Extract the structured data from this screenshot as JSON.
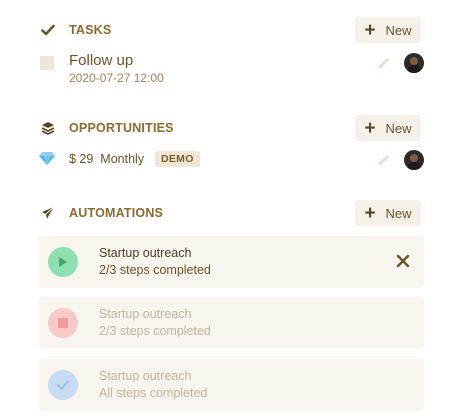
{
  "tasks": {
    "title": "TASKS",
    "new_label": "New",
    "items": [
      {
        "title": "Follow up",
        "date": "2020-07-27 12:00"
      }
    ]
  },
  "opportunities": {
    "title": "OPPORTUNITIES",
    "new_label": "New",
    "items": [
      {
        "amount": "$ 29",
        "period": "Monthly",
        "badge": "DEMO"
      }
    ]
  },
  "automations": {
    "title": "AUTOMATIONS",
    "new_label": "New",
    "items": [
      {
        "name": "Startup outreach",
        "steps": "2/3 steps completed",
        "state": "running"
      },
      {
        "name": "Startup outreach",
        "steps": "2/3 steps completed",
        "state": "stopped"
      },
      {
        "name": "Startup outreach",
        "steps": "All steps completed",
        "state": "done"
      }
    ]
  },
  "colors": {
    "accent": "#8b6a2e",
    "play": "#8ee0b0",
    "stop": "#f8c9c9",
    "done": "#c6dcf4"
  },
  "icons": {
    "tasks": "check-icon",
    "opportunities": "layers-icon",
    "automations": "paper-plane-icon",
    "edit": "pencil-icon",
    "opportunity": "diamond-icon",
    "remove": "close-icon"
  }
}
